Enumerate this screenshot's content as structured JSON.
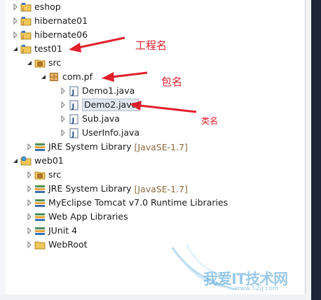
{
  "tree": [
    {
      "label": "eshop",
      "kind": "project",
      "expanded": false
    },
    {
      "label": "hibernate01",
      "kind": "project",
      "expanded": false
    },
    {
      "label": "hibernate06",
      "kind": "project",
      "expanded": false
    },
    {
      "label": "test01",
      "kind": "project",
      "expanded": true
    },
    {
      "label": "src",
      "kind": "source-folder",
      "expanded": true
    },
    {
      "label": "com.pf",
      "kind": "package",
      "expanded": true
    },
    {
      "label": "Demo1.java",
      "kind": "java-file",
      "expanded": false
    },
    {
      "label": "Demo2.java",
      "kind": "java-file",
      "expanded": false,
      "selected": true
    },
    {
      "label": "Sub.java",
      "kind": "java-file",
      "expanded": false
    },
    {
      "label": "UserInfo.java",
      "kind": "java-file",
      "expanded": false
    },
    {
      "label": "JRE System Library",
      "sublabel": "[JavaSE-1.7]",
      "kind": "library",
      "expanded": false
    },
    {
      "label": "web01",
      "kind": "web-project",
      "expanded": true
    },
    {
      "label": "src",
      "kind": "source-folder",
      "expanded": false
    },
    {
      "label": "JRE System Library",
      "sublabel": "[JavaSE-1.7]",
      "kind": "library",
      "expanded": false
    },
    {
      "label": "MyEclipse Tomcat v7.0 Runtime Libraries",
      "kind": "library",
      "expanded": false
    },
    {
      "label": "Web App Libraries",
      "kind": "library",
      "expanded": false
    },
    {
      "label": "JUnit 4",
      "kind": "library",
      "expanded": false
    },
    {
      "label": "WebRoot",
      "kind": "folder",
      "expanded": false
    }
  ],
  "annotations": {
    "project_name": "工程名",
    "package_name": "包名",
    "class_name": "类名"
  },
  "watermark": {
    "text": "我爱IT技术网",
    "url": "www.52ij.com"
  },
  "colors": {
    "annotation": "#e0202c",
    "selection": "#dfe6ef",
    "library_suffix": "#8b6a3d",
    "watermark": "#4b9fd6"
  }
}
